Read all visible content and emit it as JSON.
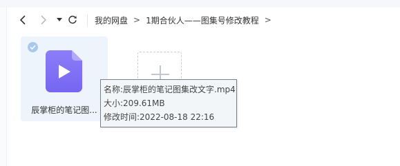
{
  "toolbar": {
    "back_icon": "chevron-left-icon",
    "forward_icon": "chevron-right-icon",
    "history_icon": "caret-down-icon",
    "refresh_icon": "refresh-icon"
  },
  "breadcrumb": {
    "items": [
      "我的网盘",
      "1期合伙人——图集号修改教程"
    ],
    "separator": ">"
  },
  "files": [
    {
      "name": "辰掌柜的笔记图...",
      "type": "video",
      "icon": "video-file-icon",
      "selected": true,
      "icon_color": "#7b6cf6"
    }
  ],
  "add_tile": {
    "icon": "plus-icon"
  },
  "tooltip": {
    "name_line": "名称:辰掌柜的笔记图集改文字.mp4",
    "size_line": "大小:209.61MB",
    "modified_line": "修改时间:2022-08-18 22:16"
  },
  "colors": {
    "selection_bg": "#edf4fc",
    "check_badge": "#a9c8ee",
    "tooltip_bg": "#f3f6f9",
    "tooltip_border": "#7a7f86"
  }
}
